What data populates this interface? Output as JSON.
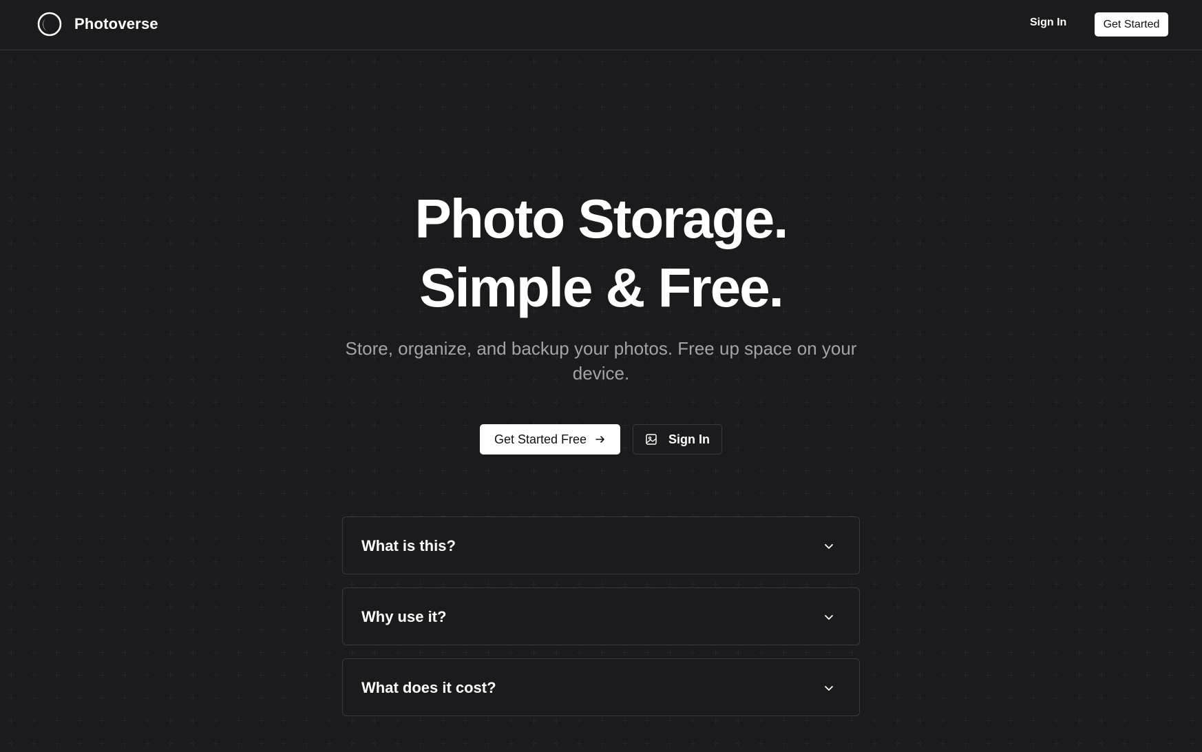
{
  "header": {
    "brand_name": "Photoverse",
    "nav_sign_in": "Sign In",
    "nav_get_started": "Get Started"
  },
  "hero": {
    "title_line1": "Photo Storage.",
    "title_line2": "Simple & Free.",
    "subtitle": "Store, organize, and backup your photos. Free up space on your device.",
    "primary_cta": "Get Started Free",
    "secondary_cta": "Sign In"
  },
  "faq": {
    "items": [
      {
        "question": "What is this?"
      },
      {
        "question": "Why use it?"
      },
      {
        "question": "What does it cost?"
      }
    ]
  },
  "icons": {
    "logo": "logo-ring-icon",
    "primary_cta": "arrow-right-icon",
    "secondary_cta": "image-icon",
    "faq_toggle": "chevron-down-icon"
  },
  "colors": {
    "background": "#1b1b1d",
    "text": "#ffffff",
    "muted_text": "#a3a3a8",
    "border": "#3a3a3e",
    "button_light": "#ffffff"
  }
}
